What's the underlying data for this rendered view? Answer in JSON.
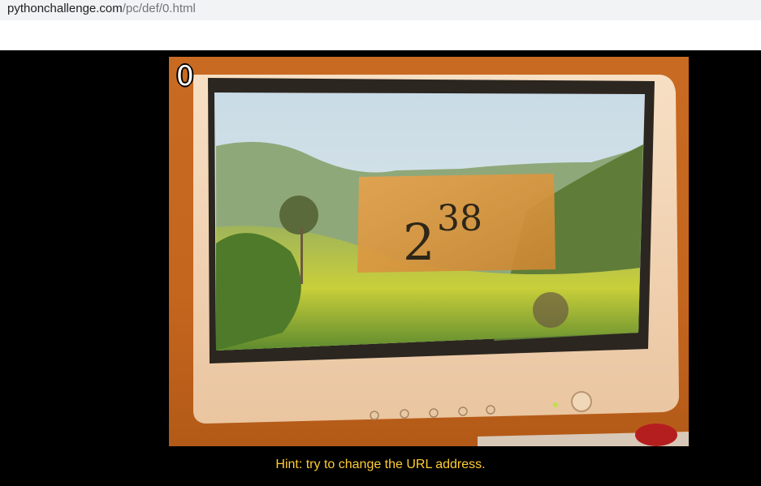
{
  "browser": {
    "url_host": "pythonchallenge.com",
    "url_path": "/pc/def/0.html"
  },
  "page": {
    "level_number": "0",
    "image_description": "CRT monitor showing a landscape with a parchment sign reading 2^38",
    "formula_base": "2",
    "formula_exponent": "38",
    "hint": "Hint: try to change the URL address."
  }
}
